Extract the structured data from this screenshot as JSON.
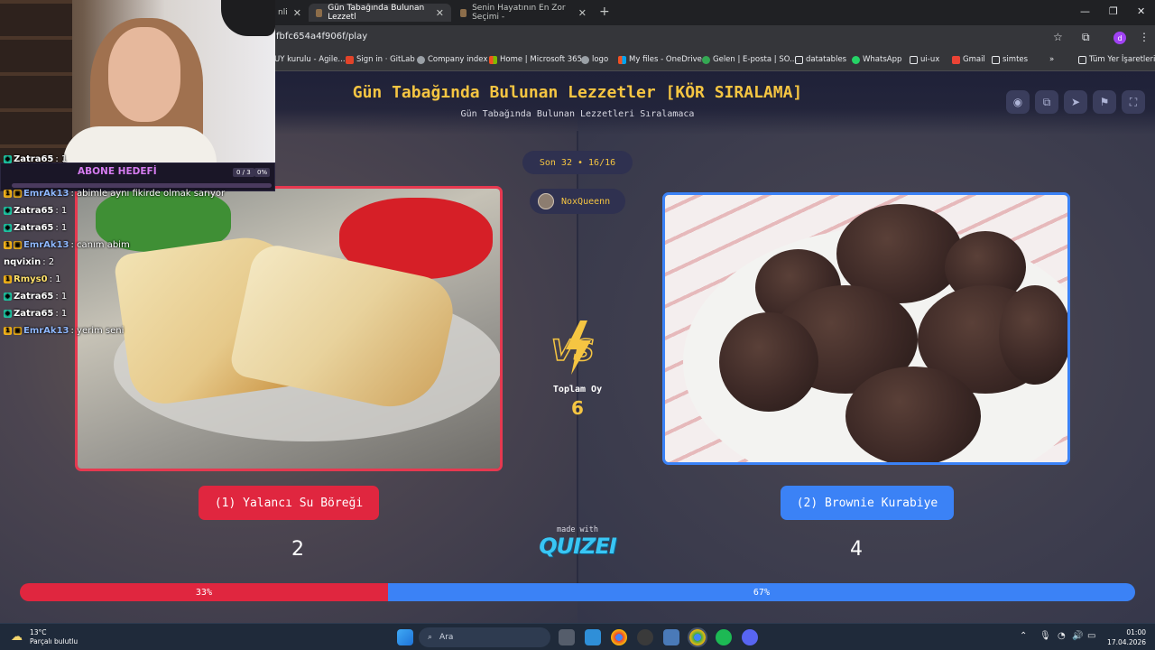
{
  "browser": {
    "tabs": [
      {
        "title": "nli"
      },
      {
        "title": "Gün Tabağında Bulunan Lezzetl"
      },
      {
        "title": "Senin Hayatının En Zor Seçimi -"
      }
    ],
    "url": "fbfc654a4f906f/play",
    "bookmarks": [
      "UY kurulu - Agile...",
      "Sign in · GitLab",
      "Company index",
      "Home | Microsoft 365",
      "logo",
      "My files - OneDrive",
      "Gelen | E-posta | SO...",
      "datatables",
      "WhatsApp",
      "ui-ux",
      "Gmail",
      "simtes",
      "»",
      "Tüm Yer İşaretleri"
    ],
    "profile_initial": "d"
  },
  "quiz": {
    "title": "Gün Tabağında Bulunan Lezzetler [KÖR SIRALAMA]",
    "subtitle": "Gün Tabağında Bulunan Lezzetleri Sıralamaca",
    "round": "Son 32 • 16/16",
    "user": "NoxQueenn",
    "total_votes_label": "Toplam Oy",
    "total_votes": "6",
    "left": {
      "label": "(1) Yalancı Su Böreği",
      "score": "2",
      "percent": 33,
      "percent_label": "33%",
      "color": "#e0263f"
    },
    "right": {
      "label": "(2) Brownie Kurabiye",
      "score": "4",
      "percent": 67,
      "percent_label": "67%",
      "color": "#3b82f6"
    },
    "made_with": "made with",
    "brand": "QUIZEI"
  },
  "stream": {
    "goal_label": "ABONE HEDEFİ",
    "goal_count": "0 / 3",
    "goal_percent": "0%",
    "chat": [
      {
        "badge": "sub",
        "name": "Zatra65",
        "text": ": 1",
        "color": "white"
      },
      {
        "badge": "gift",
        "name": "EmrAk13",
        "text": ": abimle aynı fikirde olmak sarıyor",
        "color": "blue"
      },
      {
        "badge": "sub",
        "name": "Zatra65",
        "text": ": 1",
        "color": "white"
      },
      {
        "badge": "sub",
        "name": "Zatra65",
        "text": ": 1",
        "color": "white"
      },
      {
        "badge": "gift",
        "name": "EmrAk13",
        "text": ": canım abim",
        "color": "blue"
      },
      {
        "badge": "",
        "name": "nqvixin",
        "text": ": 2",
        "color": "white"
      },
      {
        "badge": "",
        "name": "Rmys0",
        "text": ": 1",
        "color": "yellow"
      },
      {
        "badge": "sub",
        "name": "Zatra65",
        "text": ": 1",
        "color": "white"
      },
      {
        "badge": "sub",
        "name": "Zatra65",
        "text": ": 1",
        "color": "white"
      },
      {
        "badge": "gift",
        "name": "EmrAk13",
        "text": ": yerim seni",
        "color": "blue"
      }
    ]
  },
  "taskbar": {
    "temp": "13°C",
    "weather": "Parçalı bulutlu",
    "search_placeholder": "Ara",
    "time": "01:00",
    "date": "17.04.2026"
  }
}
